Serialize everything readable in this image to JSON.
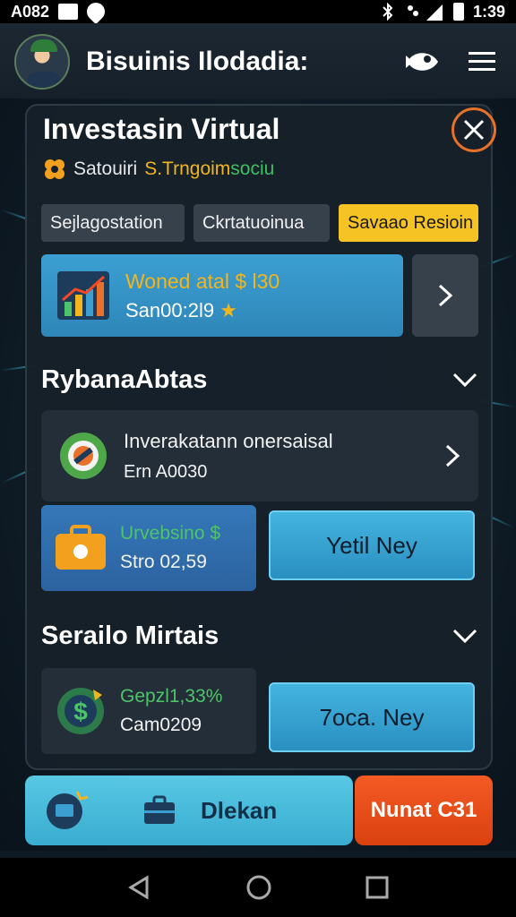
{
  "status_bar": {
    "left_text": "A082",
    "time": "1:39"
  },
  "app_bar": {
    "title": "Bisuinis Ilodadia:",
    "avatar_icon": "avatar",
    "action_icon": "fish-logo-icon",
    "menu_icon": "hamburger-menu-icon"
  },
  "panel": {
    "title": "Investasin Virtual",
    "close_icon": "close-icon",
    "subtitle": {
      "part1": "Satouiri",
      "part2": "S.Trngoim",
      "part3": "sociu"
    },
    "tabs": [
      {
        "label": "Sejlagostation",
        "active": false
      },
      {
        "label": "Ckrtatuoinua",
        "active": false
      },
      {
        "label": "Savaao Resioin",
        "active": true
      }
    ],
    "hero": {
      "line1": "Woned atal $ l30",
      "line2": "San00:2l9"
    },
    "section1": {
      "title": "RybanaAbtas",
      "list_item": {
        "title": "Inverakatann onersaisal",
        "subtitle": "Ern A0030"
      },
      "feature": {
        "line1": "Urvebsino",
        "line2": "Stro 02,59"
      },
      "button_label": "Yetil Ney"
    },
    "section2": {
      "title": "Serailo Mirtais",
      "feature": {
        "line1": "Gepzl1,33%",
        "line2": "Cam0209"
      },
      "button_label": "7oca. Ney"
    }
  },
  "bottom_bar": {
    "main_label": "Dlekan",
    "cta_label": "Nunat C31"
  },
  "colors": {
    "accent_yellow": "#f6c325",
    "accent_blue": "#3b9fd2",
    "accent_orange": "#e8712a",
    "cta_red": "#e04a15",
    "positive_green": "#4ec46a"
  }
}
